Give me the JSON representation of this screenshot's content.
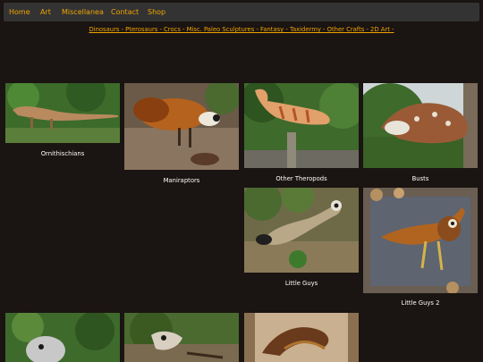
{
  "nav": {
    "items": [
      {
        "label": "Home"
      },
      {
        "label": "Art"
      },
      {
        "label": "Miscellanea"
      },
      {
        "label": "Contact"
      },
      {
        "label": "Shop"
      }
    ]
  },
  "categories_line": "Dinosaurs - Pterosaurs - Crocs - Misc. Paleo Sculptures - Fantasy - Taxidermy - Other Crafts - 2D Art -",
  "gallery": {
    "items": [
      {
        "caption": "Ornithischians"
      },
      {
        "caption": "Maniraptors"
      },
      {
        "caption": "Other Theropods"
      },
      {
        "caption": "Busts"
      },
      {
        "caption": "Little Guys"
      },
      {
        "caption": "Little Guys 2"
      }
    ]
  },
  "colors": {
    "background": "#1a1412",
    "navbar": "#333333",
    "link": "#f0a500",
    "caption": "#ffffff"
  }
}
